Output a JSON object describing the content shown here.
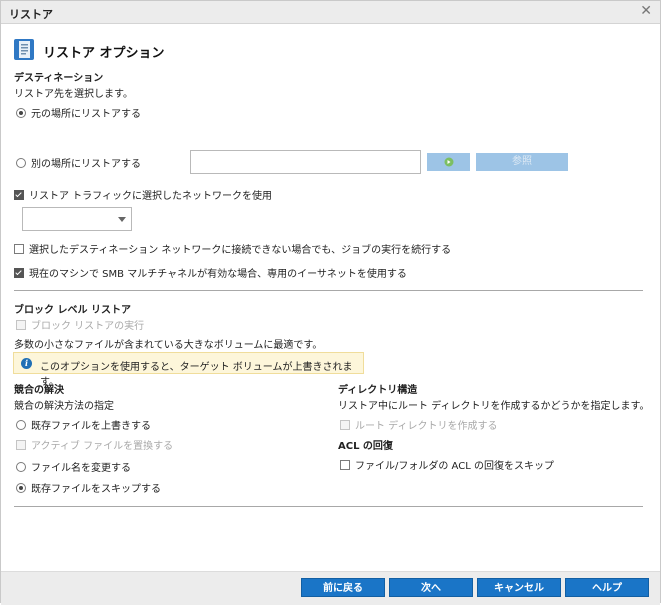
{
  "window": {
    "title": "リストア"
  },
  "header": {
    "title": "リストア オプション"
  },
  "destination": {
    "heading": "デスティネーション",
    "subtitle": "リストア先を選択します。",
    "original_location": "元の場所にリストアする",
    "other_location": "別の場所にリストアする",
    "browse_label": "参照",
    "network_traffic": "リストア トラフィックに選択したネットワークを使用",
    "continue_if_unreachable": "選択したデスティネーション ネットワークに接続できない場合でも、ジョブの実行を続行する",
    "smb_multichannel": "現在のマシンで SMB マルチチャネルが有効な場合、専用のイーサネットを使用する"
  },
  "block_level": {
    "heading": "ブロック レベル リストア",
    "run_block_restore": "ブロック リストアの実行",
    "description": "多数の小さなファイルが含まれている大きなボリュームに最適です。",
    "warning": "このオプションを使用すると、ターゲット ボリュームが上書きされます。"
  },
  "conflict": {
    "heading": "競合の解決",
    "subtitle": "競合の解決方法の指定",
    "overwrite_existing": "既存ファイルを上書きする",
    "replace_active": "アクティブ ファイルを置換する",
    "rename_files": "ファイル名を変更する",
    "skip_existing": "既存ファイルをスキップする"
  },
  "directory": {
    "heading": "ディレクトリ構造",
    "subtitle": "リストア中にルート ディレクトリを作成するかどうかを指定します。",
    "create_root": "ルート ディレクトリを作成する"
  },
  "acl": {
    "heading": "ACL の回復",
    "skip_acl": "ファイル/フォルダの ACL の回復をスキップ"
  },
  "footer": {
    "back": "前に戻る",
    "next": "次へ",
    "cancel": "キャンセル",
    "help": "ヘルプ"
  },
  "colors": {
    "primary_button": "#1a75c7",
    "disabled_button": "#9dc4e6",
    "warning_bg": "#fdf6da",
    "info_icon": "#1f6fb5"
  }
}
